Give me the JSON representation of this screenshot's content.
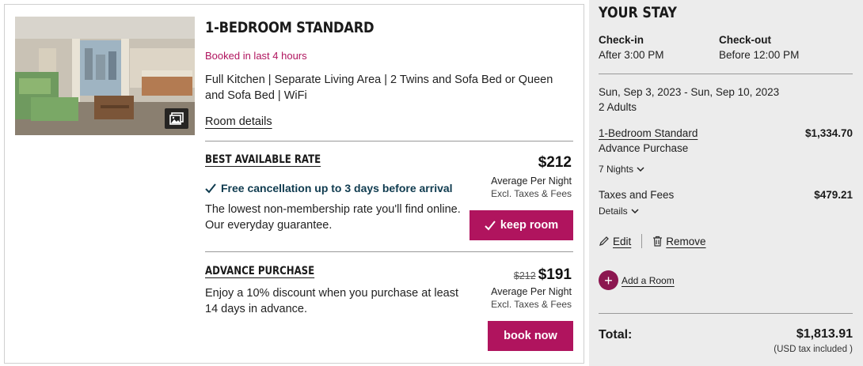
{
  "room": {
    "name": "1-BEDROOM STANDARD",
    "booked_notice": "Booked in last 4 hours",
    "amenities": "Full Kitchen | Separate Living Area | 2 Twins and Sofa Bed or Queen and Sofa Bed | WiFi",
    "details_link": "Room details"
  },
  "rates": [
    {
      "title": "BEST AVAILABLE RATE",
      "cancellation": "Free cancellation up to 3 days before arrival",
      "description": "The lowest non-membership rate you'll find online. Our everyday guarantee.",
      "price": "$212",
      "price_label": "Average Per Night",
      "price_note": "Excl. Taxes & Fees",
      "button": "keep room"
    },
    {
      "title": "ADVANCE PURCHASE",
      "description": "Enjoy a 10% discount when you purchase at least 14 days in advance.",
      "old_price": "$212",
      "price": "$191",
      "price_label": "Average Per Night",
      "price_note": "Excl. Taxes & Fees",
      "button": "book now"
    }
  ],
  "stay": {
    "title": "YOUR STAY",
    "checkin_label": "Check-in",
    "checkin_value": "After 3:00 PM",
    "checkout_label": "Check-out",
    "checkout_value": "Before 12:00 PM",
    "dates": "Sun, Sep 3, 2023 - Sun, Sep 10, 2023",
    "guests": "2 Adults",
    "room_name": "1-Bedroom Standard",
    "room_rate": "Advance Purchase",
    "room_amount": "$1,334.70",
    "nights": "7 Nights",
    "taxes_label": "Taxes and Fees",
    "taxes_amount": "$479.21",
    "details_label": "Details",
    "edit_label": "Edit",
    "remove_label": "Remove",
    "add_room_label": "Add a Room",
    "total_label": "Total:",
    "total_amount": "$1,813.91",
    "total_note": "(USD tax included )"
  },
  "colors": {
    "accent": "#b0145e",
    "add_room": "#8c1650",
    "cancel_text": "#0f3b4f",
    "sidebar_bg": "#ececec"
  }
}
